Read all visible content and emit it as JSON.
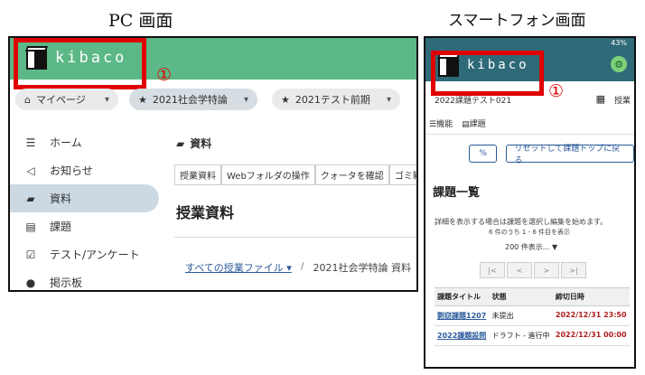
{
  "captions": {
    "pc": "PC 画面",
    "smartphone": "スマートフォン画面"
  },
  "annotation": {
    "number": "①",
    "color": "#e00000"
  },
  "brand": {
    "name": "kibaco"
  },
  "colors": {
    "pc_header": "#5cb886",
    "sp_header": "#2f6a78",
    "link": "#2a5a99",
    "due": "#b01e1e"
  },
  "pc": {
    "nav": {
      "mypage_label": "マイページ",
      "course_label": "2021社会学特論",
      "term_label": "2021テスト前期"
    },
    "sidebar": {
      "items": [
        {
          "label": "ホーム",
          "icon": "list-icon"
        },
        {
          "label": "お知らせ",
          "icon": "megaphone-icon"
        },
        {
          "label": "資料",
          "icon": "folder-icon"
        },
        {
          "label": "課題",
          "icon": "document-icon"
        },
        {
          "label": "テスト/アンケート",
          "icon": "checkbox-icon"
        },
        {
          "label": "掲示板",
          "icon": "chat-icon"
        }
      ],
      "active": "資料"
    },
    "main": {
      "title": "資料",
      "tabs": [
        {
          "label": "授業資料"
        },
        {
          "label": "Webフォルダの操作"
        },
        {
          "label": "クォータを確認"
        },
        {
          "label": "ゴミ箱"
        }
      ],
      "section_title": "授業資料",
      "breadcrumb": {
        "link": "すべての授業ファイル ▾",
        "separator": "/",
        "current": "2021社会学特論 資料"
      }
    }
  },
  "smartphone": {
    "status": {
      "battery": "43%"
    },
    "course_subtitle": "2022課題テスト021",
    "menu_label": "授業",
    "tools": {
      "function_label": "機能",
      "assignment_label": "課題"
    },
    "buttons": {
      "link_label": "%",
      "reset_label": "リセットして課題トップに戻る"
    },
    "list_title": "課題一覧",
    "info_text": "詳細を表示する場合は課題を選択し編集を始めます。",
    "count_text": "6 件のうち 1 - 6 件目を表示",
    "page_size": "200 件表示...",
    "pager": {
      "first": "|<",
      "prev": "<",
      "next": ">",
      "last": ">|"
    },
    "table": {
      "headers": [
        "課題タイトル",
        "状態",
        "締切日時"
      ],
      "rows": [
        {
          "title": "剽窃課題1207",
          "status": "未提出",
          "due": "2022/12/31 23:50"
        },
        {
          "title": "2022課題設問",
          "status": "ドラフト - 進行中",
          "due": "2022/12/31 00:00"
        }
      ]
    }
  }
}
